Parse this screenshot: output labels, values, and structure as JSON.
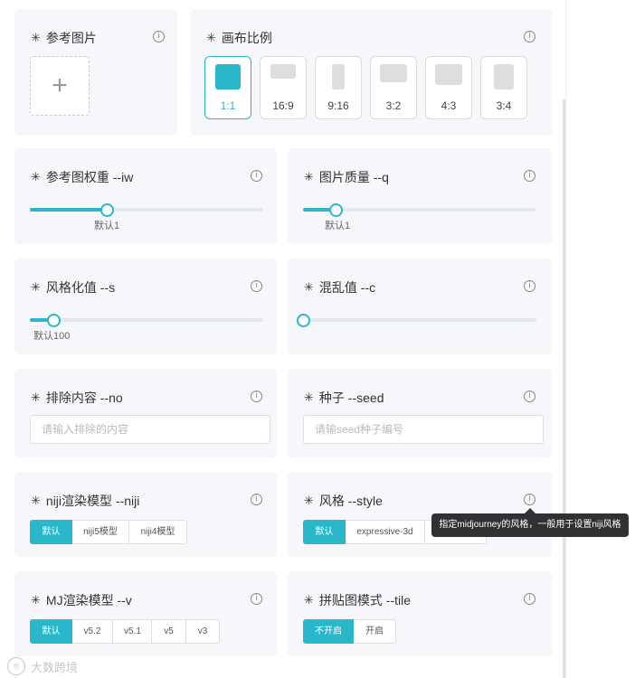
{
  "asterisk": "✳",
  "info_glyph": "i",
  "reference_image": {
    "title": "参考图片",
    "upload_glyph": "+"
  },
  "canvas_ratio": {
    "title": "画布比例",
    "options": [
      {
        "label": "1:1",
        "active": true
      },
      {
        "label": "16:9",
        "active": false
      },
      {
        "label": "9:16",
        "active": false
      },
      {
        "label": "3:2",
        "active": false
      },
      {
        "label": "4:3",
        "active": false
      },
      {
        "label": "3:4",
        "active": false
      }
    ]
  },
  "image_weight": {
    "title": "参考图权重 --iw",
    "hint": "默认1",
    "fill_fraction": 0.33
  },
  "quality": {
    "title": "图片质量 --q",
    "hint": "默认1",
    "fill_fraction": 0.14
  },
  "stylize": {
    "title": "风格化值 --s",
    "hint": "默认100",
    "fill_fraction": 0.1
  },
  "chaos": {
    "title": "混乱值 --c",
    "fill_fraction": 0.0
  },
  "no_content": {
    "title": "排除内容 --no",
    "placeholder": "请输入排除的内容"
  },
  "seed": {
    "title": "种子 --seed",
    "placeholder": "请输seed种子编号"
  },
  "niji_model": {
    "title": "niji渲染模型 --niji",
    "options": [
      "默认",
      "niji5模型",
      "niji4模型"
    ],
    "active_index": 0
  },
  "style": {
    "title": "风格 --style",
    "options": [
      "默认",
      "expressive-3d",
      ""
    ],
    "active_index": 0,
    "tooltip": "指定midjourney的风格，一般用于设置niji风格"
  },
  "mj_model": {
    "title": "MJ渲染模型 --v",
    "options": [
      "默认",
      "v5.2",
      "v5.1",
      "v5",
      "v3"
    ],
    "active_index": 0
  },
  "tile": {
    "title": "拼贴图模式 --tile",
    "options": [
      "不开启",
      "开启"
    ],
    "active_index": 0
  },
  "watermark": {
    "logo": "℗",
    "text": "大数跨境"
  },
  "colors": {
    "accent": "#2ab7c9",
    "card_bg": "#f6f7fa",
    "tooltip_bg": "#303133"
  }
}
